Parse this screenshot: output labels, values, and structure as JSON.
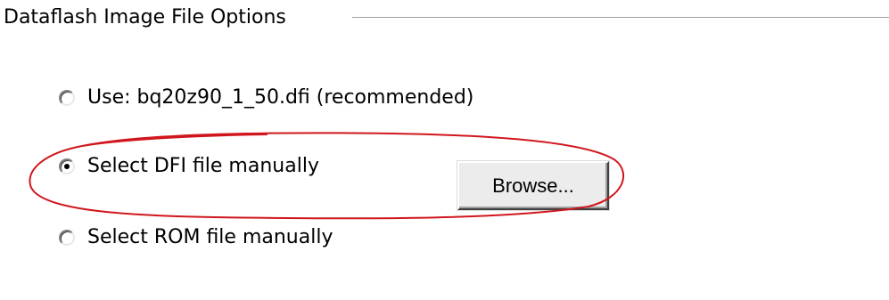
{
  "group": {
    "title": "Dataflash Image File Options"
  },
  "options": [
    {
      "label": "Use: bq20z90_1_50.dfi (recommended)",
      "checked": false
    },
    {
      "label": "Select DFI file manually",
      "checked": true
    },
    {
      "label": "Select ROM file manually",
      "checked": false
    }
  ],
  "browse_button": {
    "label": "Browse..."
  },
  "annotation": {
    "color": "#d0161d"
  }
}
